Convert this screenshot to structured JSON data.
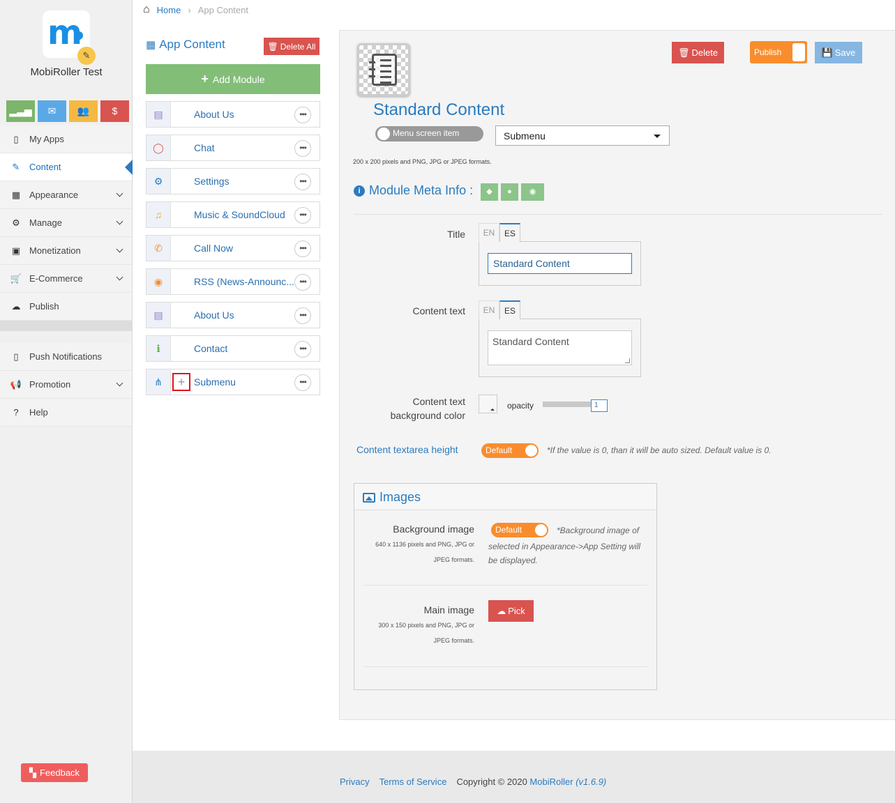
{
  "app": {
    "name": "MobiRoller Test",
    "logo_letter": "m",
    "logo_edit_icon": "pencil-icon"
  },
  "quick_buttons": [
    {
      "name": "stats",
      "icon": "signal-icon",
      "glyph": "▂▃▅",
      "color": "#7cb56b"
    },
    {
      "name": "mail",
      "icon": "envelope-icon",
      "glyph": "✉",
      "color": "#5aa9e6"
    },
    {
      "name": "users",
      "icon": "users-icon",
      "glyph": "👥",
      "color": "#f5b942"
    },
    {
      "name": "billing",
      "icon": "dollar-icon",
      "glyph": "$",
      "color": "#d9534f"
    }
  ],
  "nav": {
    "primary": [
      {
        "id": "my-apps",
        "label": "My Apps",
        "glyph": "▯",
        "icon": "mobile-icon",
        "chevron": false
      },
      {
        "id": "content",
        "label": "Content",
        "glyph": "✎",
        "icon": "edit-icon",
        "chevron": false,
        "active": true
      },
      {
        "id": "appearance",
        "label": "Appearance",
        "glyph": "▦",
        "icon": "grid-icon",
        "chevron": true
      },
      {
        "id": "manage",
        "label": "Manage",
        "glyph": "⚙",
        "icon": "gears-icon",
        "chevron": true
      },
      {
        "id": "monetization",
        "label": "Monetization",
        "glyph": "▣",
        "icon": "money-icon",
        "chevron": true
      },
      {
        "id": "ecommerce",
        "label": "E-Commerce",
        "glyph": "🛒",
        "icon": "cart-icon",
        "chevron": true
      },
      {
        "id": "publish",
        "label": "Publish",
        "glyph": "☁",
        "icon": "cloud-upload-icon",
        "chevron": false
      }
    ],
    "secondary": [
      {
        "id": "push",
        "label": "Push Notifications",
        "glyph": "▯",
        "icon": "mobile-icon",
        "chevron": false
      },
      {
        "id": "promotion",
        "label": "Promotion",
        "glyph": "📢",
        "icon": "bullhorn-icon",
        "chevron": true
      },
      {
        "id": "help",
        "label": "Help",
        "glyph": "?",
        "icon": "question-icon",
        "chevron": false
      }
    ]
  },
  "feedback": {
    "label": "Feedback"
  },
  "breadcrumb": {
    "home": "Home",
    "current": "App Content"
  },
  "module_list": {
    "title": "App Content",
    "delete_all": "Delete All",
    "add_module": "Add Module",
    "items": [
      {
        "label": "About Us",
        "icon": "building-icon",
        "glyph": "▤",
        "color": "#8e7cc3"
      },
      {
        "label": "Chat",
        "icon": "comment-icon",
        "glyph": "◯",
        "color": "#e2574c"
      },
      {
        "label": "Settings",
        "icon": "gear-icon",
        "glyph": "⚙",
        "color": "#2b7bc0"
      },
      {
        "label": "Music & SoundCloud",
        "icon": "music-icon",
        "glyph": "♫",
        "color": "#f5a623"
      },
      {
        "label": "Call Now",
        "icon": "phone-icon",
        "glyph": "✆",
        "color": "#f98d2e"
      },
      {
        "label": "RSS (News-Announc...",
        "icon": "rss-icon",
        "glyph": "◉",
        "color": "#f98d2e"
      },
      {
        "label": "About Us",
        "icon": "building-icon",
        "glyph": "▤",
        "color": "#8e7cc3"
      },
      {
        "label": "Contact",
        "icon": "info-icon",
        "glyph": "ℹ",
        "color": "#5fae4f"
      },
      {
        "label": "Submenu",
        "icon": "sitemap-icon",
        "glyph": "⋔",
        "color": "#2b7bc0",
        "has_plus": true
      }
    ]
  },
  "editor": {
    "delete_label": "Delete",
    "publish_label": "Publish",
    "save_label": "Save",
    "module_title": "Standard Content",
    "menu_screen_item": "Menu screen item",
    "type_select": "Submenu",
    "icon_hint": "200 x 200 pixels and PNG, JPG or JPEG formats.",
    "meta_info": "Module Meta Info :",
    "title_label": "Title",
    "lang_tabs": [
      "EN",
      "ES"
    ],
    "title_value": "Standard Content",
    "content_text_label": "Content text",
    "content_text_value": "Standard Content",
    "bg_color_label_1": "Content text",
    "bg_color_label_2": "background color",
    "opacity_label": "opacity",
    "opacity_value": "1",
    "textarea_height_label": "Content textarea height",
    "default_label": "Default",
    "textarea_height_note": "*If the value is 0, than it will be auto sized. Default value is 0.",
    "images": {
      "title": "Images",
      "bg_image_label": "Background image",
      "bg_image_hint_1": "640 x 1136 pixels and PNG, JPG or",
      "bg_image_hint_2": "JPEG formats.",
      "bg_default": "Default",
      "bg_note_1": "*Background image of",
      "bg_note_2": "selected in Appearance->App Setting will",
      "bg_note_3": "be displayed.",
      "main_image_label": "Main image",
      "main_image_hint_1": "300 x 150 pixels and PNG, JPG or",
      "main_image_hint_2": "JPEG formats.",
      "pick_label": "Pick"
    }
  },
  "footer": {
    "privacy": "Privacy",
    "terms": "Terms of Service",
    "copyright": "Copyright © 2020",
    "brand": "MobiRoller",
    "version": "(v1.6.9)"
  },
  "colors": {
    "accent_blue": "#2b7bc0",
    "danger": "#d9534f",
    "success": "#82be78",
    "orange": "#f98d2e",
    "save_blue": "#86b6e2"
  }
}
